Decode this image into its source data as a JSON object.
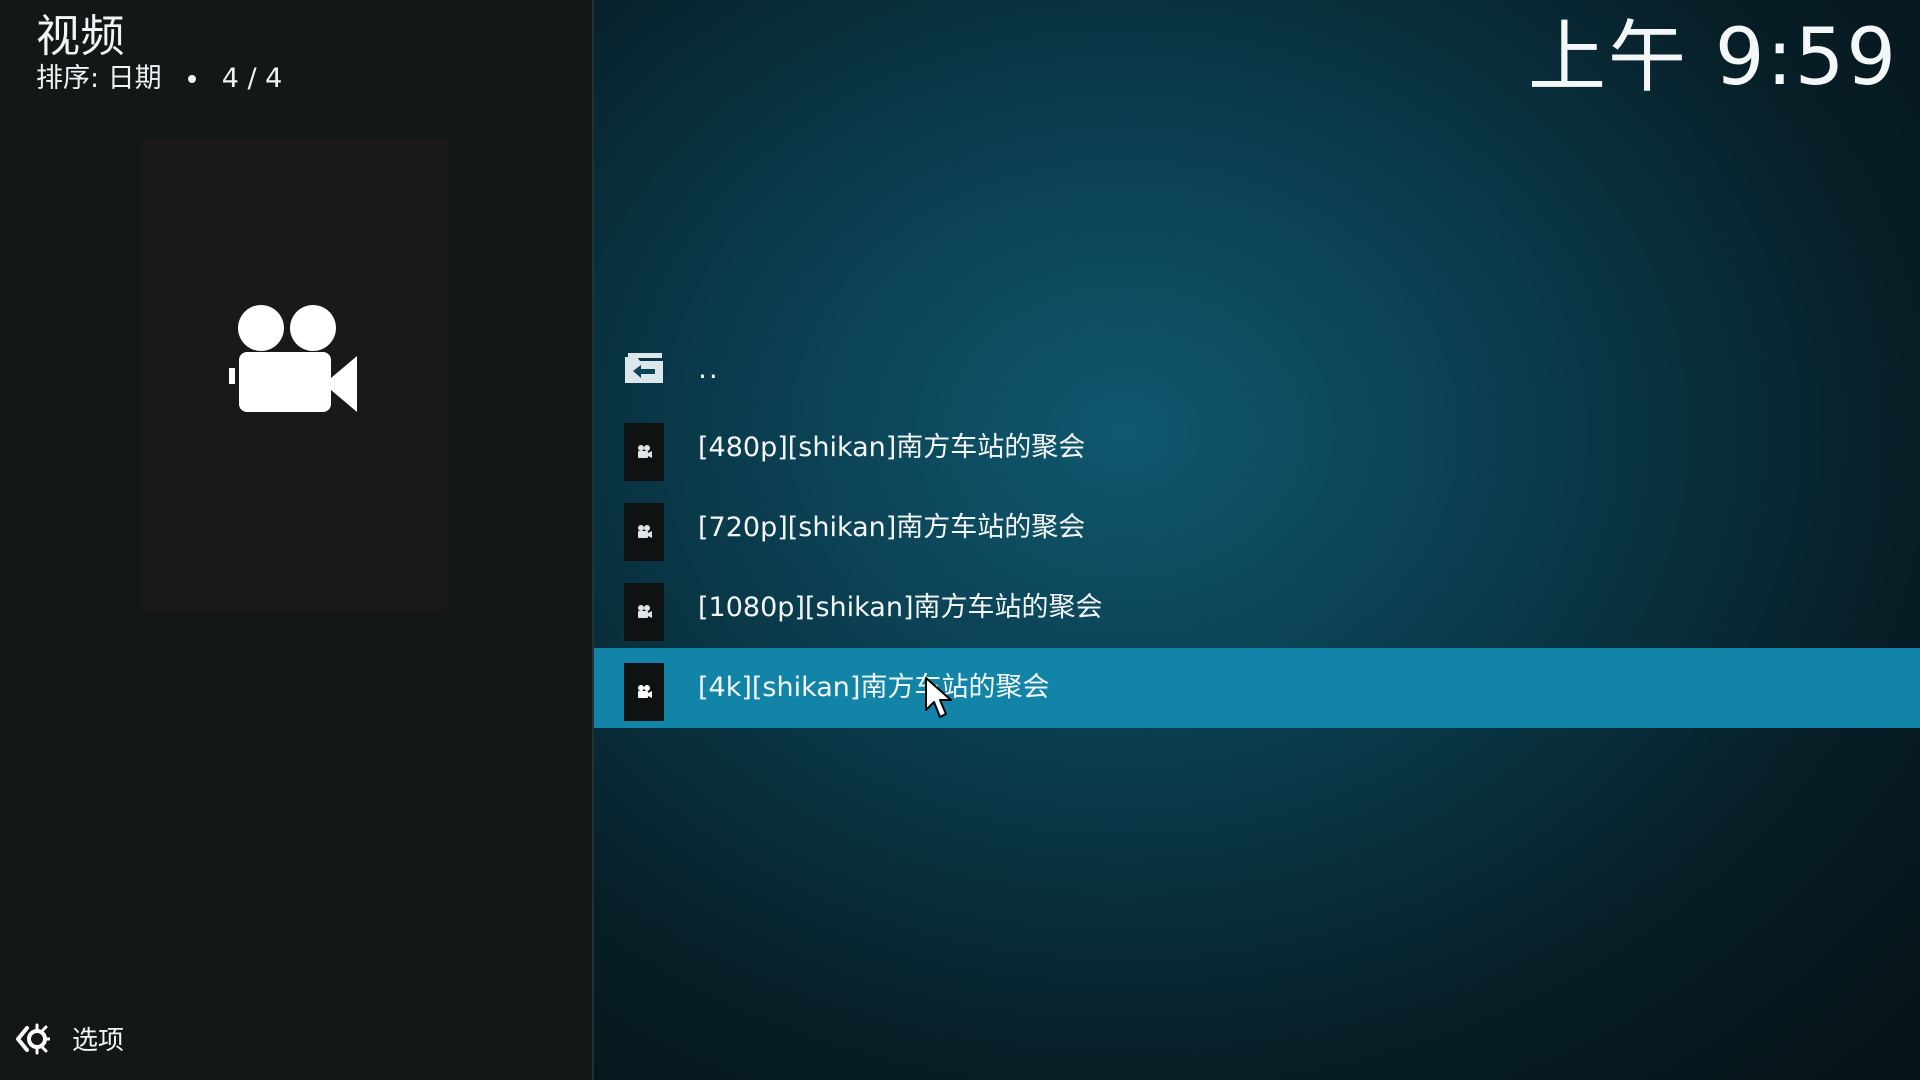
{
  "header": {
    "title": "视频",
    "sort_label": "排序: 日期",
    "position": "4 / 4"
  },
  "clock": {
    "time": "上午 9:59"
  },
  "sidebar": {
    "thumbnail_icon": "video-camera-icon",
    "options_label": "选项",
    "options_icon": "settings-arrow-icon"
  },
  "file_list": {
    "items": [
      {
        "label": "..",
        "icon": "parent-folder-icon"
      },
      {
        "label": "[480p][shikan]南方车站的聚会",
        "icon": "video-file-icon"
      },
      {
        "label": "[720p][shikan]南方车站的聚会",
        "icon": "video-file-icon"
      },
      {
        "label": "[1080p][shikan]南方车站的聚会",
        "icon": "video-file-icon"
      },
      {
        "label": "[4k][shikan]南方车站的聚会",
        "icon": "video-file-icon",
        "selected": true
      }
    ]
  },
  "colors": {
    "selection": "#1184a8",
    "left_panel": "#141717",
    "thumbnail_bg": "#1a1818"
  }
}
